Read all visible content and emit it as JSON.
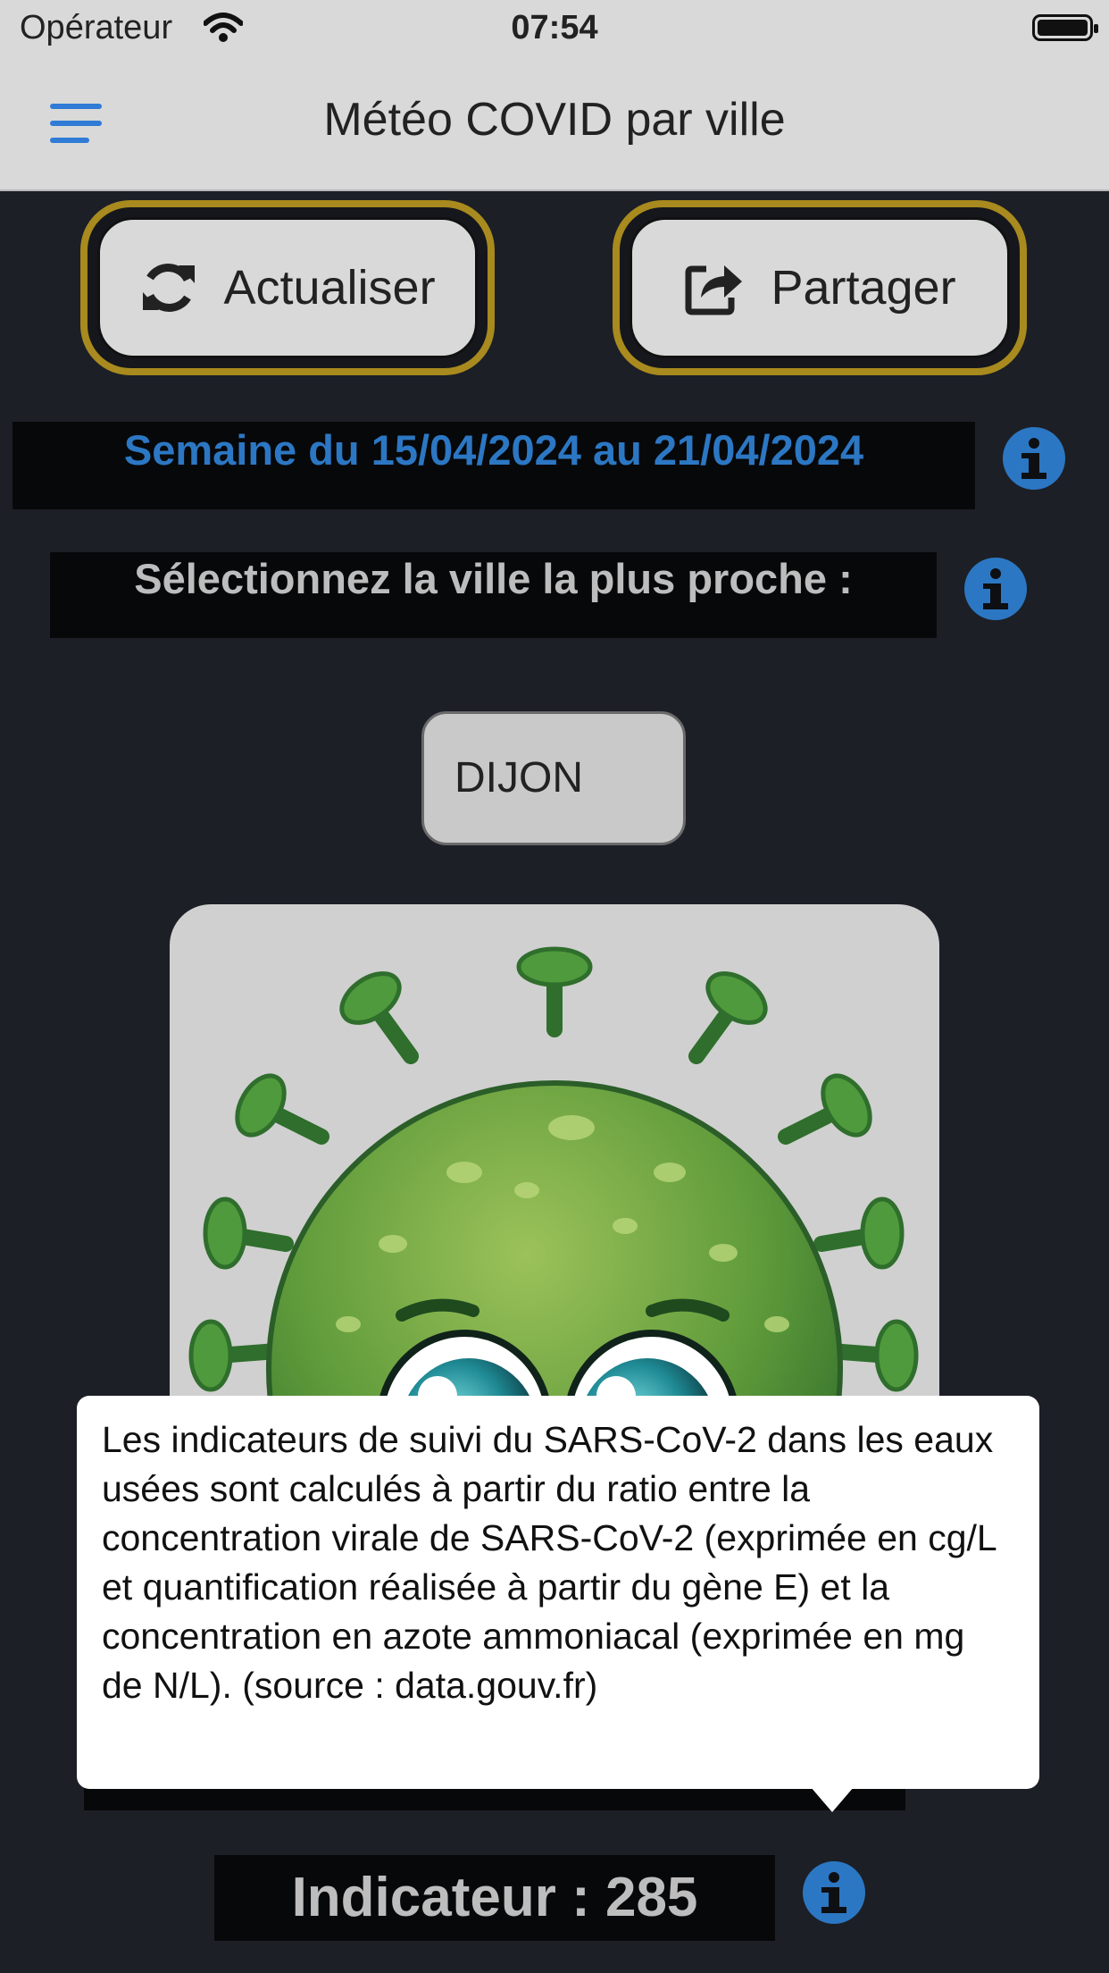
{
  "status_bar": {
    "operator": "Opérateur",
    "time": "07:54"
  },
  "nav": {
    "title": "Météo COVID par ville"
  },
  "buttons": {
    "refresh_label": "Actualiser",
    "share_label": "Partager"
  },
  "week": {
    "label": "Semaine du 15/04/2024 au 21/04/2024"
  },
  "city": {
    "prompt": "Sélectionnez la ville la plus proche :",
    "selected": "DIJON"
  },
  "tooltip": {
    "text": "Les indicateurs de suivi du SARS-CoV-2 dans les eaux usées sont calculés à partir du ratio entre la concentration virale de SARS-CoV-2 (exprimée en cg/L et quantification réalisée à partir du gène E) et la concentration en azote ammoniacal (exprimée en mg de N/L). (source : data.gouv.fr)"
  },
  "indicator": {
    "label": "Indicateur : 285"
  },
  "colors": {
    "accent_blue": "#2c77c3",
    "button_border": "#a88a1e",
    "background": "#1c1f26"
  }
}
